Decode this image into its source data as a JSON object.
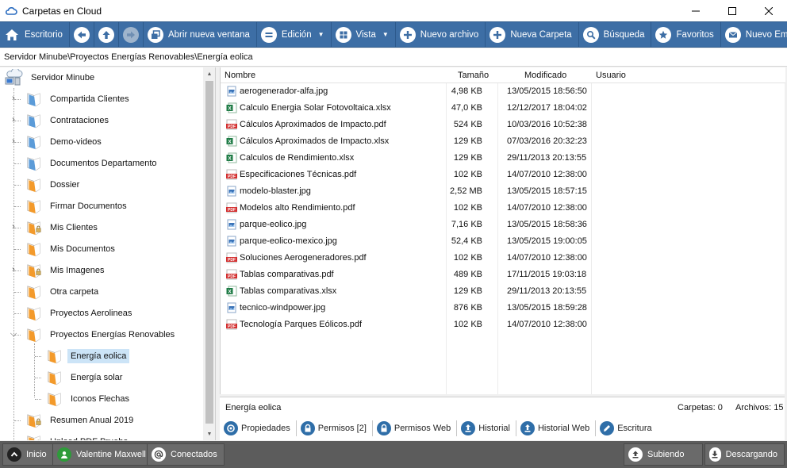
{
  "window": {
    "title": "Carpetas en Cloud"
  },
  "toolbar": {
    "escritorio": "Escritorio",
    "abrir_nueva_ventana": "Abrir nueva ventana",
    "edicion": "Edición",
    "vista": "Vista",
    "nuevo_archivo": "Nuevo archivo",
    "nueva_carpeta": "Nueva Carpeta",
    "busqueda": "Búsqueda",
    "favoritos": "Favoritos",
    "nuevo_email": "Nuevo Email"
  },
  "path": "Servidor Minube\\Proyectos Energías Renovables\\Energía eolica",
  "tree": {
    "root": "Servidor Minube",
    "items": [
      {
        "label": "Compartida Clientes"
      },
      {
        "label": "Contrataciones"
      },
      {
        "label": "Demo-videos"
      },
      {
        "label": "Documentos Departamento"
      },
      {
        "label": "Dossier"
      },
      {
        "label": "Firmar Documentos"
      },
      {
        "label": "Mis Clientes"
      },
      {
        "label": "Mis Documentos"
      },
      {
        "label": "Mis Imagenes"
      },
      {
        "label": "Otra carpeta"
      },
      {
        "label": "Proyectos Aerolineas"
      },
      {
        "label": "Proyectos Energías Renovables"
      },
      {
        "label": "Energía eolica"
      },
      {
        "label": "Energía solar"
      },
      {
        "label": "Iconos Flechas"
      },
      {
        "label": "Resumen Anual 2019"
      },
      {
        "label": "Upload PDF Prueba"
      }
    ]
  },
  "filelist": {
    "headers": {
      "name": "Nombre",
      "size": "Tamaño",
      "modified": "Modificado",
      "user": "Usuario"
    },
    "rows": [
      {
        "name": "aerogenerador-alfa.jpg",
        "size": "4,98 KB",
        "modified": "13/05/2015 18:56:50",
        "type": "jpg"
      },
      {
        "name": "Calculo Energia Solar Fotovoltaica.xlsx",
        "size": "47,0 KB",
        "modified": "12/12/2017 18:04:02",
        "type": "xlsx"
      },
      {
        "name": "Cálculos Aproximados de Impacto.pdf",
        "size": "524 KB",
        "modified": "10/03/2016 10:52:38",
        "type": "pdf"
      },
      {
        "name": "Cálculos Aproximados de Impacto.xlsx",
        "size": "129 KB",
        "modified": "07/03/2016 20:32:23",
        "type": "xlsx"
      },
      {
        "name": "Calculos de Rendimiento.xlsx",
        "size": "129 KB",
        "modified": "29/11/2013 20:13:55",
        "type": "xlsx"
      },
      {
        "name": "Especificaciones Técnicas.pdf",
        "size": "102 KB",
        "modified": "14/07/2010 12:38:00",
        "type": "pdf"
      },
      {
        "name": "modelo-blaster.jpg",
        "size": "2,52 MB",
        "modified": "13/05/2015 18:57:15",
        "type": "jpg"
      },
      {
        "name": "Modelos alto Rendimiento.pdf",
        "size": "102 KB",
        "modified": "14/07/2010 12:38:00",
        "type": "pdf"
      },
      {
        "name": "parque-eolico.jpg",
        "size": "7,16 KB",
        "modified": "13/05/2015 18:58:36",
        "type": "jpg"
      },
      {
        "name": "parque-eolico-mexico.jpg",
        "size": "52,4 KB",
        "modified": "13/05/2015 19:00:05",
        "type": "jpg"
      },
      {
        "name": "Soluciones Aerogeneradores.pdf",
        "size": "102 KB",
        "modified": "14/07/2010 12:38:00",
        "type": "pdf"
      },
      {
        "name": "Tablas comparativas.pdf",
        "size": "489 KB",
        "modified": "17/11/2015 19:03:18",
        "type": "pdf"
      },
      {
        "name": "Tablas comparativas.xlsx",
        "size": "129 KB",
        "modified": "29/11/2013 20:13:55",
        "type": "xlsx"
      },
      {
        "name": "tecnico-windpower.jpg",
        "size": "876 KB",
        "modified": "13/05/2015 18:59:28",
        "type": "jpg"
      },
      {
        "name": "Tecnología Parques Eólicos.pdf",
        "size": "102 KB",
        "modified": "14/07/2010 12:38:00",
        "type": "pdf"
      }
    ]
  },
  "infobar": {
    "folder": "Energía eolica",
    "carpetas": "Carpetas: 0",
    "archivos": "Archivos: 15"
  },
  "tabs": {
    "propiedades": "Propiedades",
    "permisos": "Permisos [2]",
    "permisos_web": "Permisos Web",
    "historial": "Historial",
    "historial_web": "Historial Web",
    "escritura": "Escritura"
  },
  "statusbar": {
    "inicio": "Inicio",
    "user": "Valentine Maxwell",
    "conectados": "Conectados",
    "subiendo": "Subiendo",
    "descargando": "Descargando"
  },
  "colors": {
    "toolbar": "#3d6ea5",
    "statusbar": "#5c5c5c",
    "selection": "#cce4f7",
    "pdf": "#d32f2f",
    "xlsx": "#1e7b45",
    "jpg": "#3a73b8"
  }
}
